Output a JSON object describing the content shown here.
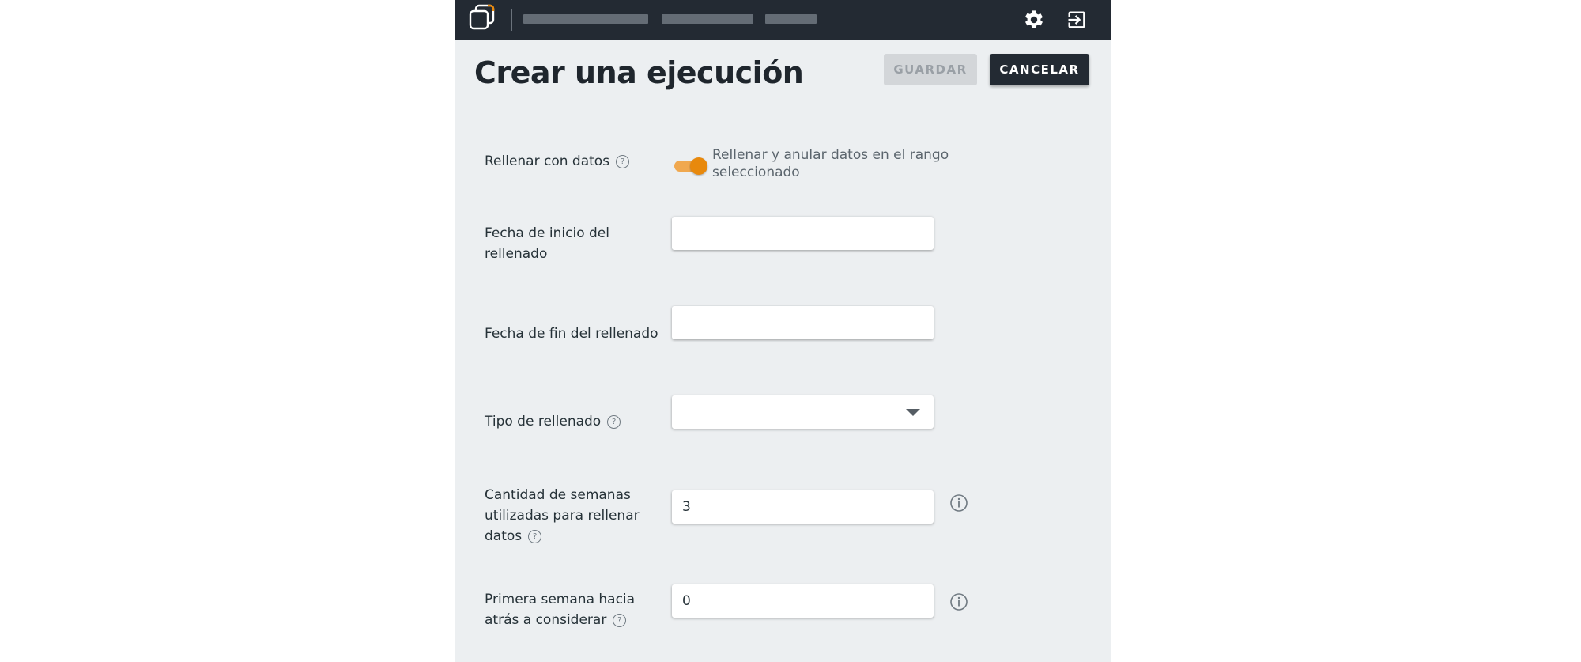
{
  "colors": {
    "topbar": "#232a33",
    "background": "#eceff1",
    "accent": "#e8890d",
    "primary_button": "#232a33",
    "disabled_button": "#d3d6d9"
  },
  "header": {
    "logo_icon": "logo-icon",
    "settings_icon": "gear-icon",
    "logout_icon": "logout-icon"
  },
  "page": {
    "title": "Crear una ejecución",
    "save_label": "GUARDAR",
    "cancel_label": "CANCELAR"
  },
  "form": {
    "fill_data": {
      "label": "Rellenar con datos",
      "help_icon": "help-icon",
      "toggle_on": true,
      "toggle_description": "Rellenar y anular datos en el rango seleccionado"
    },
    "start_date": {
      "label": "Fecha de inicio del rellenado",
      "value": ""
    },
    "end_date": {
      "label": "Fecha de fin del rellenado",
      "value": ""
    },
    "fill_type": {
      "label": "Tipo de rellenado",
      "help_icon": "help-icon",
      "selected": ""
    },
    "weeks_used": {
      "label": "Cantidad de semanas utilizadas para rellenar datos",
      "value": "3",
      "info_icon": "info-icon"
    },
    "first_week_back": {
      "label": "Primera semana hacia atrás a considerar",
      "value": "0",
      "info_icon": "info-icon"
    }
  }
}
